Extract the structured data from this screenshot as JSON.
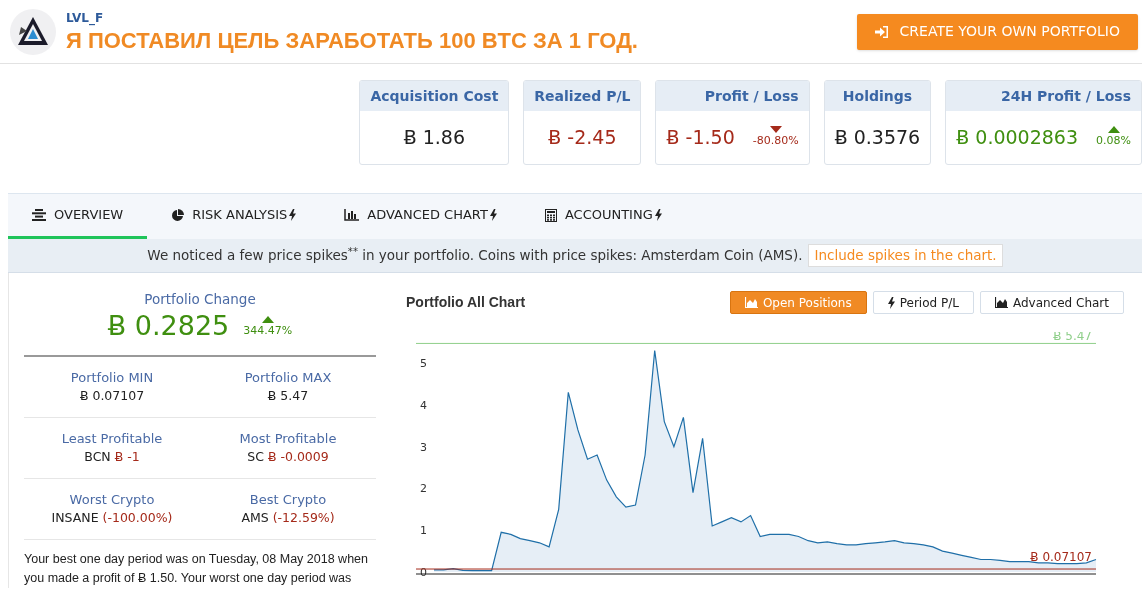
{
  "header": {
    "username": "LVL_F",
    "title": "Я ПОСТАВИЛ ЦЕЛЬ ЗАРАБОТАТЬ 100 BTC ЗА 1 ГОД.",
    "cta": "CREATE YOUR OWN PORTFOLIO"
  },
  "stats": [
    {
      "label": "Acquisition Cost",
      "value": "Ƀ 1.86",
      "kind": "neutral"
    },
    {
      "label": "Realized P/L",
      "value": "Ƀ -2.45",
      "kind": "loss"
    },
    {
      "label": "Profit / Loss",
      "value": "Ƀ -1.50",
      "kind": "loss",
      "change": "-80.80%"
    },
    {
      "label": "Holdings",
      "value": "Ƀ 0.3576",
      "kind": "neutral"
    },
    {
      "label": "24H Profit / Loss",
      "value": "Ƀ 0.0002863",
      "kind": "gain",
      "change": "0.08%"
    }
  ],
  "tabs": [
    {
      "label": "OVERVIEW",
      "selected": true,
      "premium": false
    },
    {
      "label": "RISK ANALYSIS",
      "selected": false,
      "premium": true
    },
    {
      "label": "ADVANCED CHART",
      "selected": false,
      "premium": true
    },
    {
      "label": "ACCOUNTING",
      "selected": false,
      "premium": true
    }
  ],
  "notice": {
    "text": "We noticed a few price spikes$^{**}$ in your portfolio. Coins with price spikes: Amsterdam Coin (AMS).",
    "link": "Include spikes in the chart."
  },
  "summary": {
    "title": "Portfolio Change",
    "value": "Ƀ 0.2825",
    "change": "344.47%",
    "kind": "gain"
  },
  "metrics": [
    [
      {
        "label": "Portfolio MIN",
        "value": "Ƀ 0.07107",
        "kind": "neutral"
      },
      {
        "label": "Portfolio MAX",
        "value": "Ƀ 5.47",
        "kind": "neutral"
      }
    ],
    [
      {
        "label": "Least Profitable",
        "name": "BCN",
        "value": "Ƀ -1",
        "kind": "loss"
      },
      {
        "label": "Most Profitable",
        "name": "SC",
        "value": "Ƀ -0.0009",
        "kind": "loss"
      }
    ],
    [
      {
        "label": "Worst Crypto",
        "name": "INSANE",
        "value": "(-100.00%)",
        "kind": "loss"
      },
      {
        "label": "Best Crypto",
        "name": "AMS",
        "value": "(-12.59%)",
        "kind": "loss"
      }
    ]
  ],
  "paragraph": [
    "Your best one day period was on Tuesday, 08 May 2018 when",
    "you made a profit of Ƀ 1.50. Your worst one day period was"
  ],
  "chart_panel": {
    "title": "Portfolio All Chart",
    "buttons": [
      {
        "label": "Open Positions",
        "selected": true
      },
      {
        "label": "Period P/L",
        "selected": false
      },
      {
        "label": "Advanced Chart",
        "selected": false
      }
    ],
    "chart_data": {
      "type": "area",
      "ylim": [
        0,
        5.6
      ],
      "yticks": [
        0,
        1,
        2,
        3,
        4,
        5
      ],
      "series": [
        {
          "color": "#1f6fa8",
          "values": [
            0.05,
            0.05,
            0.08,
            0.04,
            0.03,
            0.03,
            0.03,
            0.95,
            0.9,
            0.8,
            0.75,
            0.7,
            0.6,
            1.5,
            4.3,
            3.4,
            2.7,
            2.8,
            2.2,
            1.8,
            1.55,
            1.6,
            2.8,
            5.3,
            3.6,
            3.0,
            3.7,
            1.9,
            3.2,
            1.1,
            1.2,
            1.3,
            1.2,
            1.35,
            0.85,
            0.9,
            0.9,
            0.9,
            0.85,
            0.75,
            0.7,
            0.72,
            0.68,
            0.65,
            0.65,
            0.68,
            0.7,
            0.72,
            0.75,
            0.7,
            0.68,
            0.65,
            0.6,
            0.5,
            0.45,
            0.4,
            0.35,
            0.3,
            0.3,
            0.28,
            0.25,
            0.25,
            0.25,
            0.22,
            0.22,
            0.2,
            0.2,
            0.2,
            0.22,
            0.3
          ]
        }
      ],
      "ref_lines": [
        {
          "axis": "y",
          "value": 5.47,
          "label": "Ƀ 5.47",
          "color": "#8fcf8a"
        },
        {
          "axis": "y",
          "value": 0.07107,
          "label": "Ƀ 0.07107",
          "color": "#a52a1a"
        }
      ]
    }
  }
}
